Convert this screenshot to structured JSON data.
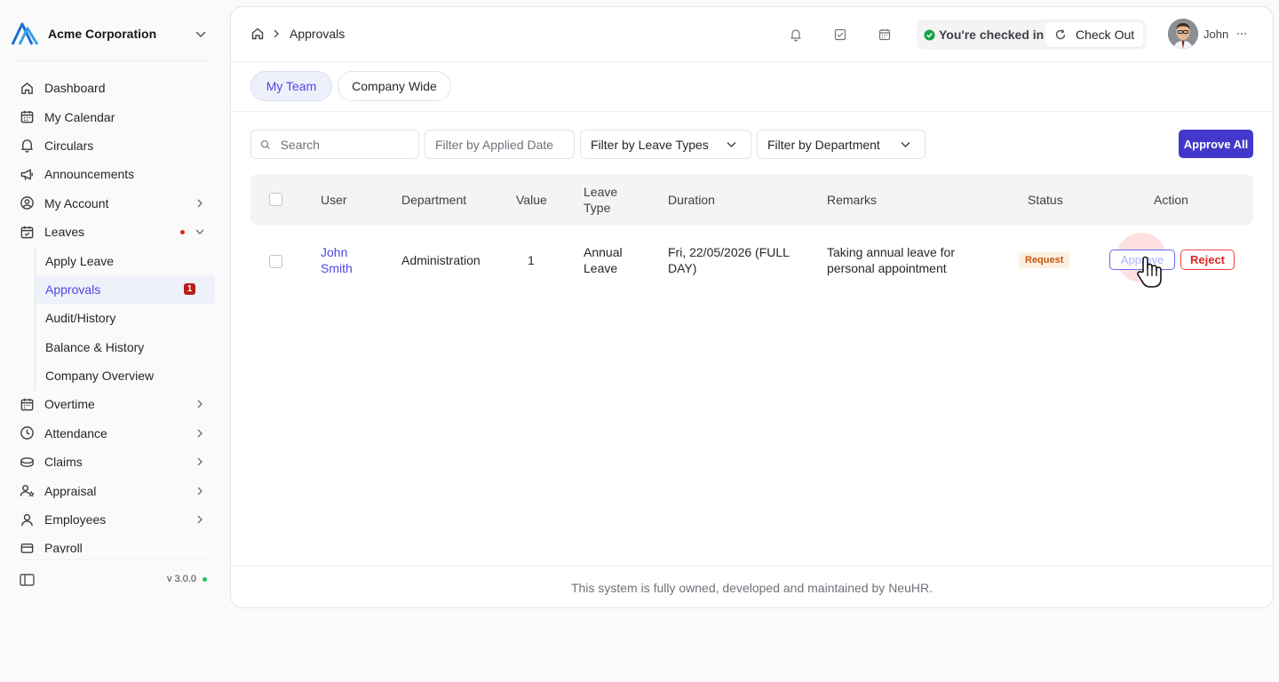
{
  "org": {
    "name": "Acme Corporation",
    "logo_icon": "acme-logo-icon"
  },
  "sidebar": {
    "items": [
      {
        "label": "Dashboard",
        "icon": "home-icon"
      },
      {
        "label": "My Calendar",
        "icon": "calendar-icon"
      },
      {
        "label": "Circulars",
        "icon": "bell-icon"
      },
      {
        "label": "Announcements",
        "icon": "megaphone-icon"
      },
      {
        "label": "My Account",
        "icon": "user-circle-icon"
      },
      {
        "label": "Leaves",
        "icon": "calendar-check-icon"
      }
    ],
    "leaves_sub": [
      {
        "label": "Apply Leave"
      },
      {
        "label": "Approvals",
        "badge": "1"
      },
      {
        "label": "Audit/History"
      },
      {
        "label": "Balance & History"
      },
      {
        "label": "Company Overview"
      }
    ],
    "items_after": [
      {
        "label": "Overtime",
        "icon": "calendar-plus-icon"
      },
      {
        "label": "Attendance",
        "icon": "clock-icon"
      },
      {
        "label": "Claims",
        "icon": "coins-icon"
      },
      {
        "label": "Appraisal",
        "icon": "user-star-icon"
      },
      {
        "label": "Employees",
        "icon": "users-icon"
      },
      {
        "label": "Payroll",
        "icon": "receipt-icon"
      }
    ],
    "version": "v 3.0.0"
  },
  "header": {
    "breadcrumb": "Approvals",
    "checkin_text": "You're checked in",
    "checkout_label": "Check Out",
    "user_name": "John"
  },
  "tabs": [
    {
      "label": "My Team",
      "active": true
    },
    {
      "label": "Company Wide",
      "active": false
    }
  ],
  "filters": {
    "search_placeholder": "Search",
    "date_placeholder": "Filter by Applied Date",
    "leave_types": "Filter by Leave Types",
    "department": "Filter by Department",
    "approve_all": "Approve All"
  },
  "table": {
    "headers": {
      "user": "User",
      "department": "Department",
      "value": "Value",
      "leave_type": "Leave Type",
      "duration": "Duration",
      "remarks": "Remarks",
      "status": "Status",
      "action": "Action"
    },
    "rows": [
      {
        "user": "John Smith",
        "department": "Administration",
        "value": "1",
        "leave_type": "Annual Leave",
        "duration": "Fri, 22/05/2026 (FULL DAY)",
        "remarks": "Taking annual leave for personal appointment",
        "status": "Request",
        "approve_label": "Approve",
        "reject_label": "Reject"
      }
    ]
  },
  "footer": {
    "text": "This system is fully owned, developed and maintained by NeuHR."
  },
  "colors": {
    "accent": "#4338ca",
    "accent_light": "#eef0fa",
    "status_request": "#c2570c",
    "danger": "#dc2626",
    "success": "#22c55e"
  }
}
